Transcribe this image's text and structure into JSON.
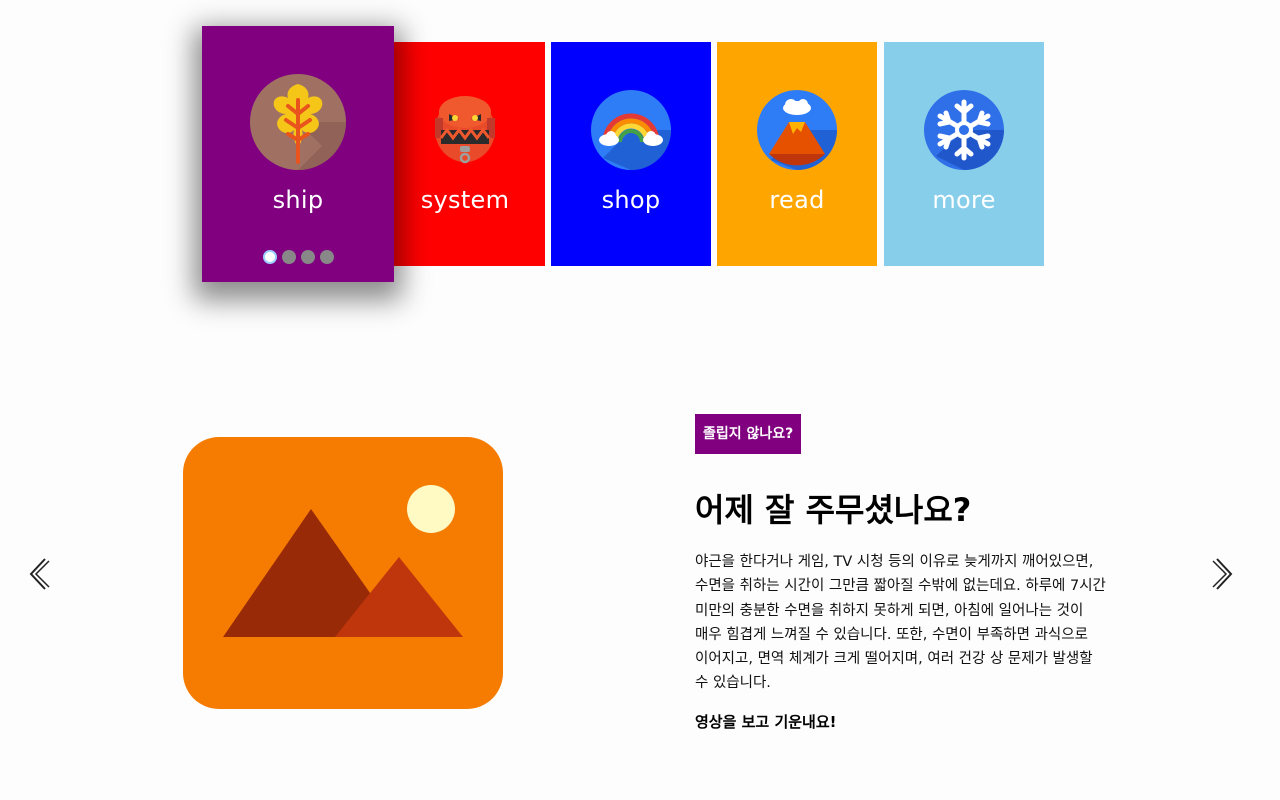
{
  "carousel": {
    "cards": [
      {
        "label": "ship",
        "color": "#800080",
        "icon": "oak-leaf-icon",
        "active": true
      },
      {
        "label": "system",
        "color": "#FF0000",
        "icon": "monster-icon",
        "active": false
      },
      {
        "label": "shop",
        "color": "#0000FF",
        "icon": "rainbow-icon",
        "active": false
      },
      {
        "label": "read",
        "color": "#FFA500",
        "icon": "volcano-icon",
        "active": false
      },
      {
        "label": "more",
        "color": "#87CEEB",
        "icon": "snowflake-icon",
        "active": false
      }
    ],
    "dots": {
      "count": 4,
      "active_index": 0
    }
  },
  "slide": {
    "image_icon": "image-placeholder-icon",
    "tag": "졸립지 않나요?",
    "headline": "어제 잘 주무셨나요?",
    "body": "야근을 한다거나 게임, TV 시청 등의 이유로 늦게까지 깨어있으면, 수면을 취하는 시간이 그만큼 짧아질 수밖에 없는데요. 하루에 7시간 미만의 충분한 수면을 취하지 못하게 되면, 아침에 일어나는 것이 매우 힘겹게 느껴질 수 있습니다. 또한, 수면이 부족하면 과식으로 이어지고, 면역 체계가 크게 떨어지며, 여러 건강 상 문제가 발생할 수 있습니다.",
    "cta": "영상을 보고 기운내요!",
    "tag_color": "#800080"
  },
  "nav": {
    "prev_icon": "chevron-left-icon",
    "next_icon": "chevron-right-icon"
  }
}
